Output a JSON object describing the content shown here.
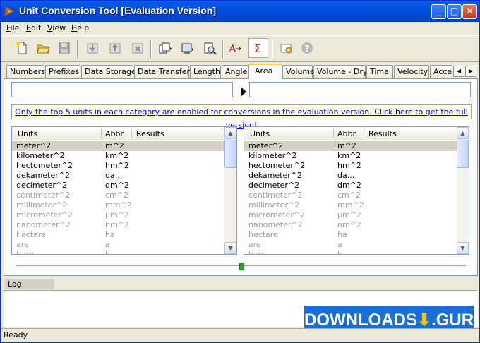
{
  "window": {
    "title": "Unit Conversion Tool [Evaluation Version]",
    "min_label": "_",
    "max_label": "□",
    "close_label": "✕"
  },
  "menu": [
    {
      "label": "File",
      "ul": "F",
      "rest": "ile"
    },
    {
      "label": "Edit",
      "ul": "E",
      "rest": "dit"
    },
    {
      "label": "View",
      "ul": "V",
      "rest": "iew"
    },
    {
      "label": "Help",
      "ul": "H",
      "rest": "elp"
    }
  ],
  "toolbar": {
    "icons": [
      "new-file-icon",
      "open-folder-icon",
      "save-disk-icon",
      "import-icon",
      "export-icon",
      "delete-icon",
      "copy-icon",
      "print-icon",
      "print-preview-icon",
      "font-icon",
      "sum-icon",
      "settings-icon",
      "help-icon"
    ]
  },
  "tabs": [
    "Numbers",
    "Prefixes",
    "Data Storage",
    "Data Transfer",
    "Length",
    "Angle",
    "Area",
    "Volume",
    "Volume - Dry",
    "Time",
    "Velocity",
    "Accel"
  ],
  "active_tab": "Area",
  "input": {
    "left_value": "",
    "right_value": ""
  },
  "eval_banner": "Only the top 5 units in each category are enabled for conversions in the evaluation version. Click here to get the full version!",
  "list_headers": {
    "units": "Units",
    "abbr": "Abbr.",
    "results": "Results"
  },
  "units": [
    {
      "unit": "meter^2",
      "abbr": "m^2",
      "enabled": true
    },
    {
      "unit": "kilometer^2",
      "abbr": "km^2",
      "enabled": true
    },
    {
      "unit": "hectometer^2",
      "abbr": "hm^2",
      "enabled": true
    },
    {
      "unit": "dekameter^2",
      "abbr": "da...",
      "enabled": true
    },
    {
      "unit": "decimeter^2",
      "abbr": "dm^2",
      "enabled": true
    },
    {
      "unit": "centimeter^2",
      "abbr": "cm^2",
      "enabled": false
    },
    {
      "unit": "millimeter^2",
      "abbr": "mm^2",
      "enabled": false
    },
    {
      "unit": "micrometer^2",
      "abbr": "µm^2",
      "enabled": false
    },
    {
      "unit": "nanometer^2",
      "abbr": "nm^2",
      "enabled": false
    },
    {
      "unit": "hectare",
      "abbr": "ha",
      "enabled": false
    },
    {
      "unit": "are",
      "abbr": "a",
      "enabled": false
    },
    {
      "unit": "barn",
      "abbr": "b",
      "enabled": false
    }
  ],
  "slider": {
    "position_fraction": 0.5
  },
  "log_window_label": "Log Window",
  "watermark": {
    "left": "DOWNLOADS",
    "arrow": "⬇",
    "right": ".GURU"
  },
  "status": "Ready"
}
